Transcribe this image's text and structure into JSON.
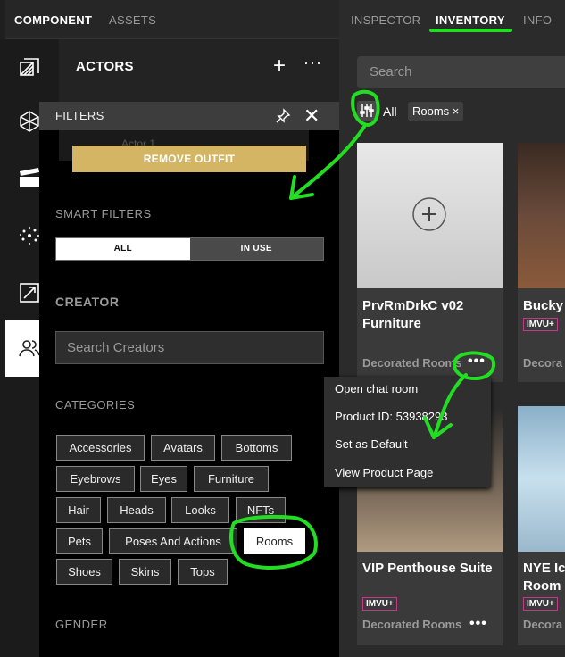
{
  "left_tabs": [
    "COMPONENT",
    "ASSETS"
  ],
  "actors": {
    "title": "ACTORS",
    "plus": "+",
    "more": "···",
    "ghost_row": "Actor 1"
  },
  "filters": {
    "title": "FILTERS",
    "close": "✕",
    "remove_outfit": "REMOVE OUTFIT",
    "smart_filters_label": "SMART FILTERS",
    "smart_all": "ALL",
    "smart_in_use": "IN USE",
    "creator_label": "CREATOR",
    "creator_placeholder": "Search Creators",
    "categories_label": "CATEGORIES",
    "categories": [
      "Accessories",
      "Avatars",
      "Bottoms",
      "Eyebrows",
      "Eyes",
      "Furniture",
      "Hair",
      "Heads",
      "Looks",
      "NFTs",
      "Pets",
      "Poses And Actions",
      "Rooms",
      "Shoes",
      "Skins",
      "Tops"
    ],
    "selected_category": "Rooms",
    "gender_label": "GENDER"
  },
  "right_tabs": [
    "INSPECTOR",
    "INVENTORY",
    "INFO"
  ],
  "active_right_tab": "INVENTORY",
  "search_placeholder": "Search",
  "filter_chips": {
    "all": "All",
    "rooms": "Rooms ×"
  },
  "cards": [
    {
      "name": "PrvRmDrkC v02 Furniture",
      "category": "Decorated Rooms",
      "dots": "•••"
    },
    {
      "name": "Bucky",
      "badge": "IMVU+",
      "category": "Decora"
    },
    {
      "name": "VIP Penthouse Suite",
      "badge": "IMVU+",
      "category": "Decorated Rooms",
      "dots": "•••"
    },
    {
      "name": "NYE Ic Room",
      "badge": "IMVU+",
      "category": "Decora"
    }
  ],
  "context_menu": [
    "Open chat room",
    "Product ID: 53938293",
    "Set as Default",
    "View Product Page"
  ],
  "annotation_color": "#22dd22",
  "accent_gold": "#d4b564"
}
